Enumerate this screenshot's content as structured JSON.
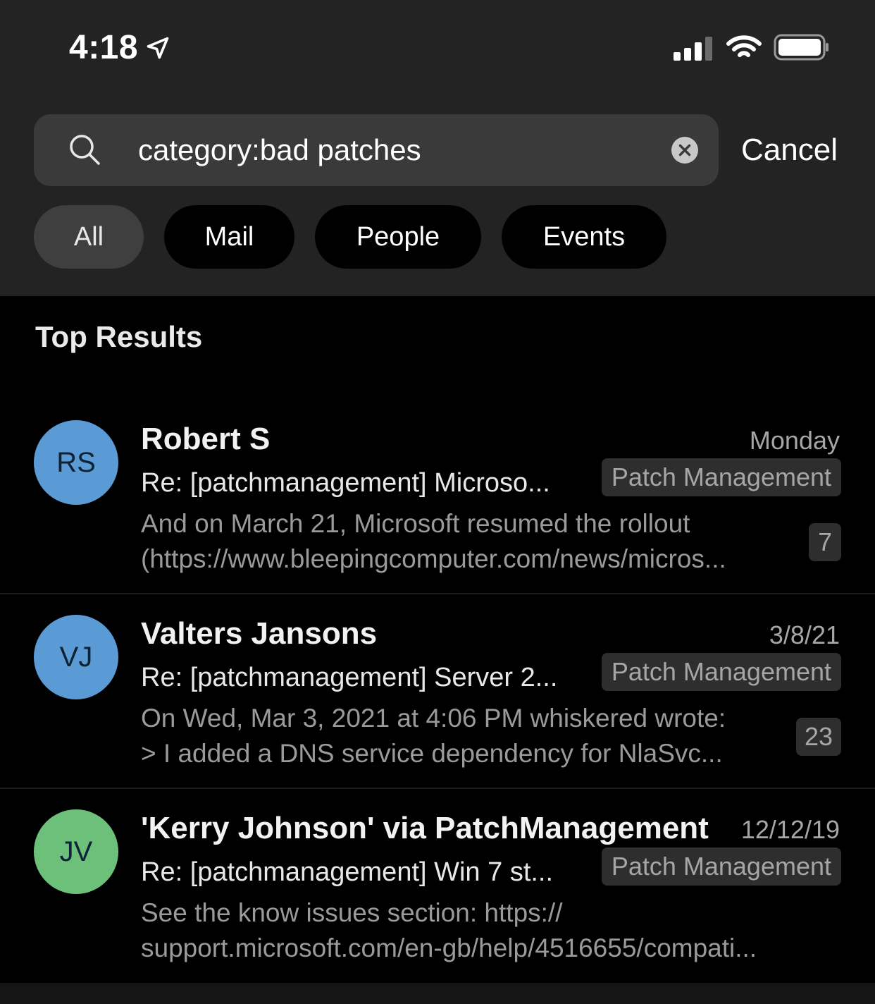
{
  "status_bar": {
    "time": "4:18"
  },
  "search": {
    "query": "category:bad patches",
    "cancel_label": "Cancel"
  },
  "filters": [
    {
      "label": "All",
      "active": true
    },
    {
      "label": "Mail",
      "active": false
    },
    {
      "label": "People",
      "active": false
    },
    {
      "label": "Events",
      "active": false
    }
  ],
  "section_title": "Top Results",
  "results": [
    {
      "initials": "RS",
      "avatar_color": "#5b9bd5",
      "sender": "Robert S",
      "date": "Monday",
      "subject": "Re: [patchmanagement] Microso...",
      "tag": "Patch Management",
      "preview_line1": "And on March 21, Microsoft resumed the rollout",
      "preview_line2": "(https://www.bleepingcomputer.com/news/micros...",
      "count": "7"
    },
    {
      "initials": "VJ",
      "avatar_color": "#5b9bd5",
      "sender": "Valters Jansons",
      "date": "3/8/21",
      "subject": "Re: [patchmanagement] Server 2...",
      "tag": "Patch Management",
      "preview_line1": "On Wed, Mar 3, 2021 at 4:06 PM whiskered wrote:",
      "preview_line2": "> I added a DNS service dependency for NlaSvc...",
      "count": "23"
    },
    {
      "initials": "JV",
      "avatar_color": "#6cc07a",
      "sender": "'Kerry Johnson' via PatchManagement",
      "date": "12/12/19",
      "subject": "Re: [patchmanagement] Win 7 st...",
      "tag": "Patch Management",
      "preview_line1": "See the know issues section: https://",
      "preview_line2": "support.microsoft.com/en-gb/help/4516655/compati...",
      "count": ""
    }
  ]
}
